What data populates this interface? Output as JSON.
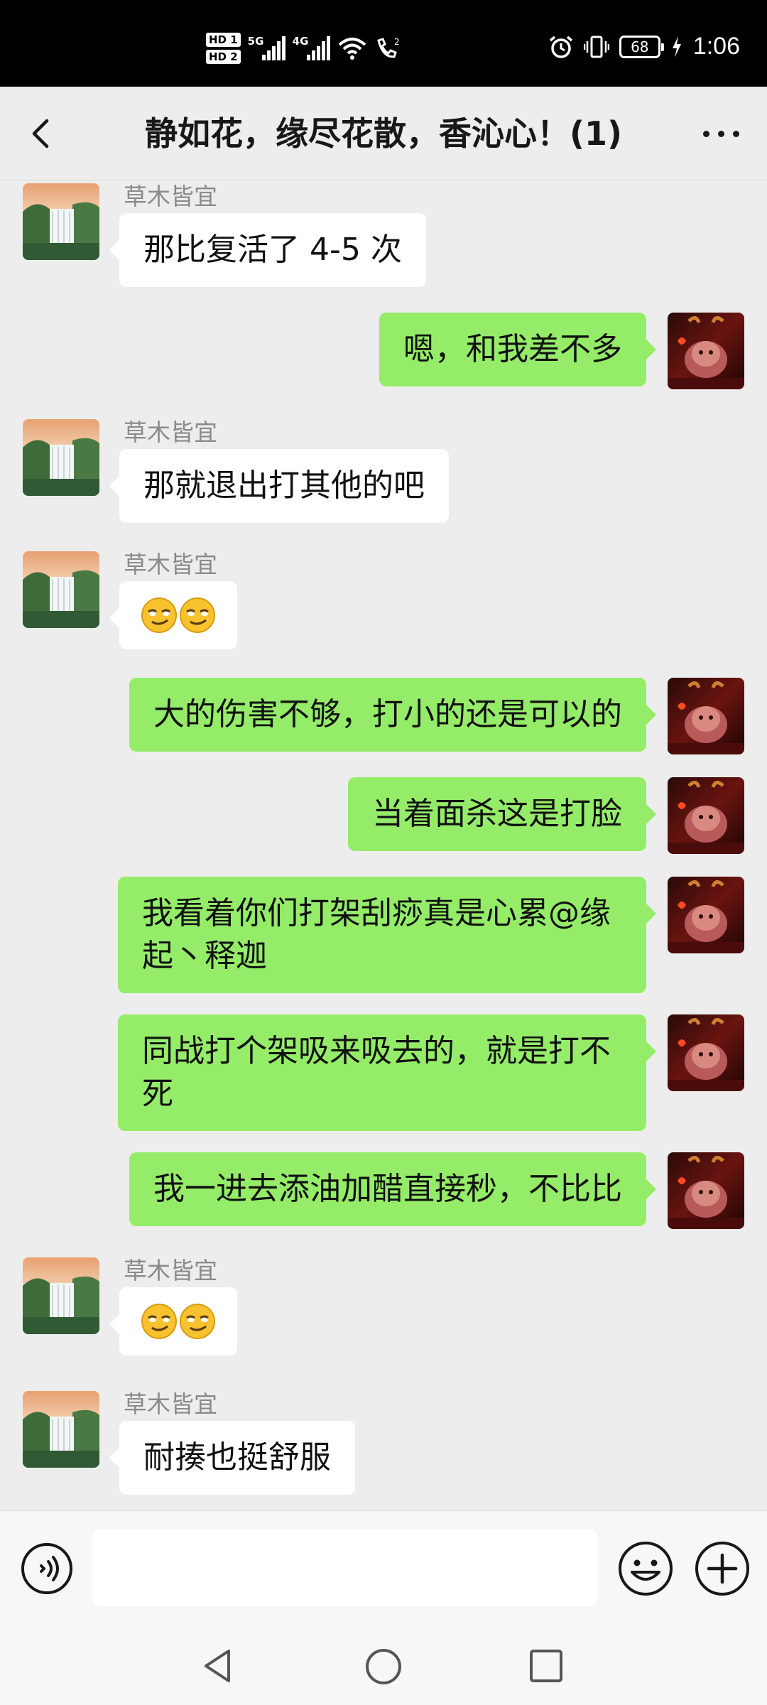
{
  "status_bar": {
    "hd1": "HD 1",
    "hd2": "HD 2",
    "net1": "5G",
    "net2": "4G",
    "call_badge": "2",
    "battery": "68",
    "time": "1:06",
    "icons": [
      "alarm-icon",
      "vibrate-icon",
      "charging-icon",
      "wifi-icon",
      "hd-call-icon"
    ]
  },
  "header": {
    "title": "静如花，缘尽花散，香沁心！(1)",
    "back_icon": "chevron-left-icon",
    "more_icon": "ellipsis-icon"
  },
  "messages": [
    {
      "side": "left",
      "sender": "草木皆宜",
      "text": "那比复活了 4-5 次"
    },
    {
      "side": "right",
      "text": "嗯，和我差不多"
    },
    {
      "side": "left",
      "sender": "草木皆宜",
      "text": "那就退出打其他的吧"
    },
    {
      "side": "left",
      "sender": "草木皆宜",
      "text": "😏😏",
      "is_emoji": true
    },
    {
      "side": "right",
      "text": "大的伤害不够，打小的还是可以的"
    },
    {
      "side": "right",
      "text": "当着面杀这是打脸"
    },
    {
      "side": "right",
      "text": "我看着你们打架刮痧真是心累@缘起丶释迦"
    },
    {
      "side": "right",
      "text": "同战打个架吸来吸去的，就是打不死"
    },
    {
      "side": "right",
      "text": "我一进去添油加醋直接秒，不比比"
    },
    {
      "side": "left",
      "sender": "草木皆宜",
      "text": "😏😏",
      "is_emoji": true
    },
    {
      "side": "left",
      "sender": "草木皆宜",
      "text": "耐揍也挺舒服"
    }
  ],
  "input_bar": {
    "placeholder": "",
    "value": "",
    "voice_icon": "voice-icon",
    "emoji_icon": "smiley-icon",
    "plus_icon": "plus-icon"
  },
  "system_nav": {
    "icons": [
      "back-triangle-icon",
      "home-circle-icon",
      "recents-square-icon"
    ]
  },
  "colors": {
    "background": "#ededed",
    "bubble_self": "#95ec69",
    "bubble_other": "#ffffff",
    "nickname": "#8a8a8a"
  }
}
